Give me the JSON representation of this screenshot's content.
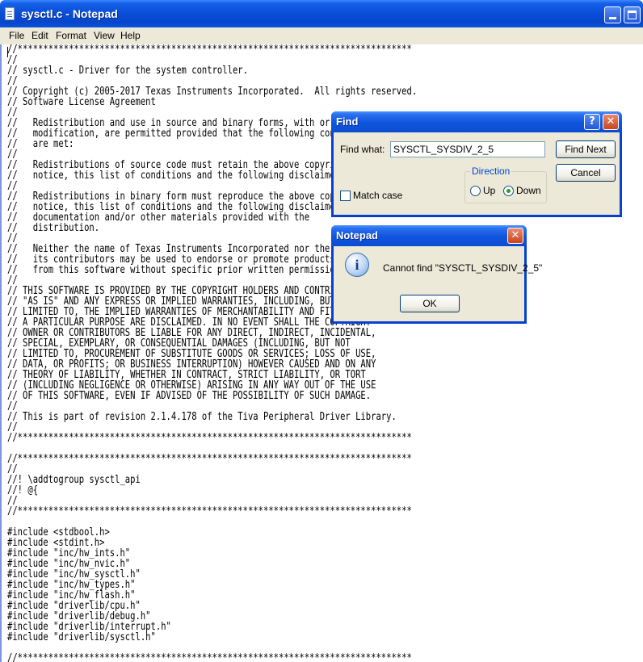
{
  "window": {
    "title": "sysctl.c - Notepad",
    "minimize_glyph": "",
    "maximize_glyph": ""
  },
  "menu": [
    "File",
    "Edit",
    "Format",
    "View",
    "Help"
  ],
  "editor": {
    "lines": [
      "//*****************************************************************************",
      "//",
      "// sysctl.c - Driver for the system controller.",
      "//",
      "// Copyright (c) 2005-2017 Texas Instruments Incorporated.  All rights reserved.",
      "// Software License Agreement",
      "//",
      "//   Redistribution and use in source and binary forms, with or without",
      "//   modification, are permitted provided that the following conditions",
      "//   are met:",
      "//",
      "//   Redistributions of source code must retain the above copyright",
      "//   notice, this list of conditions and the following disclaimer.",
      "//",
      "//   Redistributions in binary form must reproduce the above copyright",
      "//   notice, this list of conditions and the following disclaimer in the",
      "//   documentation and/or other materials provided with the",
      "//   distribution.",
      "//",
      "//   Neither the name of Texas Instruments Incorporated nor the names of",
      "//   its contributors may be used to endorse or promote products derived",
      "//   from this software without specific prior written permission.",
      "//",
      "// THIS SOFTWARE IS PROVIDED BY THE COPYRIGHT HOLDERS AND CONTRIBUTORS",
      "// \"AS IS\" AND ANY EXPRESS OR IMPLIED WARRANTIES, INCLUDING, BUT NOT",
      "// LIMITED TO, THE IMPLIED WARRANTIES OF MERCHANTABILITY AND FITNESS FOR",
      "// A PARTICULAR PURPOSE ARE DISCLAIMED. IN NO EVENT SHALL THE COPYRIGHT",
      "// OWNER OR CONTRIBUTORS BE LIABLE FOR ANY DIRECT, INDIRECT, INCIDENTAL,",
      "// SPECIAL, EXEMPLARY, OR CONSEQUENTIAL DAMAGES (INCLUDING, BUT NOT",
      "// LIMITED TO, PROCUREMENT OF SUBSTITUTE GOODS OR SERVICES; LOSS OF USE,",
      "// DATA, OR PROFITS; OR BUSINESS INTERRUPTION) HOWEVER CAUSED AND ON ANY",
      "// THEORY OF LIABILITY, WHETHER IN CONTRACT, STRICT LIABILITY, OR TORT",
      "// (INCLUDING NEGLIGENCE OR OTHERWISE) ARISING IN ANY WAY OUT OF THE USE",
      "// OF THIS SOFTWARE, EVEN IF ADVISED OF THE POSSIBILITY OF SUCH DAMAGE.",
      "//",
      "// This is part of revision 2.1.4.178 of the Tiva Peripheral Driver Library.",
      "//",
      "//*****************************************************************************",
      "",
      "//*****************************************************************************",
      "//",
      "//! \\addtogroup sysctl_api",
      "//! @{",
      "//",
      "//*****************************************************************************",
      "",
      "#include <stdbool.h>",
      "#include <stdint.h>",
      "#include \"inc/hw_ints.h\"",
      "#include \"inc/hw_nvic.h\"",
      "#include \"inc/hw_sysctl.h\"",
      "#include \"inc/hw_types.h\"",
      "#include \"inc/hw_flash.h\"",
      "#include \"driverlib/cpu.h\"",
      "#include \"driverlib/debug.h\"",
      "#include \"driverlib/interrupt.h\"",
      "#include \"driverlib/sysctl.h\"",
      "",
      "//*****************************************************************************"
    ]
  },
  "find_dialog": {
    "title": "Find",
    "help_glyph": "?",
    "close_glyph": "✕",
    "find_what_label": "Find what:",
    "find_what_value": "SYSCTL_SYSDIV_2_5",
    "find_next_label": "Find Next",
    "cancel_label": "Cancel",
    "direction_label": "Direction",
    "up_label": "Up",
    "down_label": "Down",
    "direction_selected": "Down",
    "match_case_label": "Match case",
    "match_case_checked": false
  },
  "message_box": {
    "title": "Notepad",
    "close_glyph": "✕",
    "icon": "info-icon",
    "icon_glyph": "i",
    "message": "Cannot find \"SYSCTL_SYSDIV_2_5\"",
    "ok_label": "OK"
  }
}
